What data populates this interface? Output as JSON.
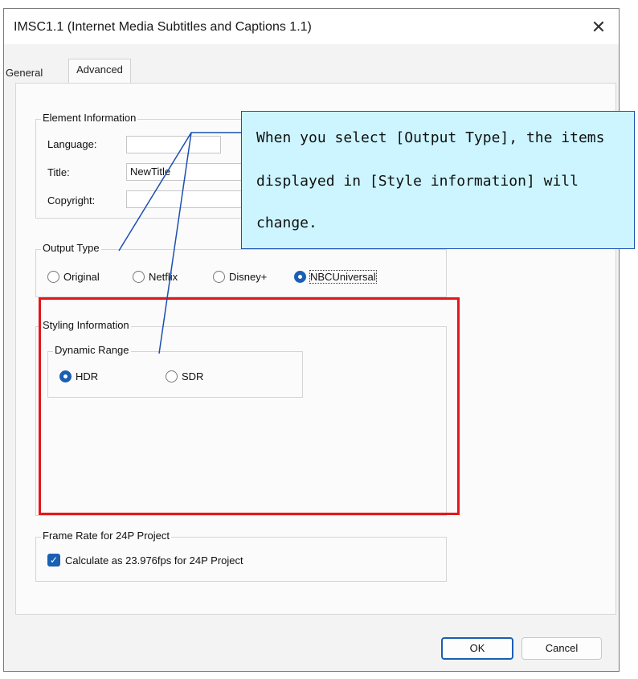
{
  "dialog": {
    "title": "IMSC1.1 (Internet Media Subtitles and Captions 1.1)",
    "close_glyph": "✕",
    "tabs": [
      "General",
      "Advanced"
    ],
    "element_info": {
      "group_label": "Element Information",
      "language_label": "Language:",
      "language_value": "",
      "title_label": "Title:",
      "title_value": "NewTitle",
      "copyright_label": "Copyright:",
      "copyright_value": ""
    },
    "output_type": {
      "group_label": "Output Type",
      "options": [
        "Original",
        "Netflix",
        "Disney+",
        "NBCUniversal"
      ],
      "selected": "NBCUniversal"
    },
    "styling": {
      "group_label": "Styling Information",
      "dynamic_range_label": "Dynamic Range",
      "options": [
        "HDR",
        "SDR"
      ],
      "selected": "HDR"
    },
    "frame_rate": {
      "group_label": "Frame Rate for 24P Project",
      "checkbox_label": "Calculate as 23.976fps for 24P Project",
      "checked": true,
      "check_glyph": "✓"
    },
    "buttons": {
      "ok": "OK",
      "cancel": "Cancel"
    }
  },
  "callout": {
    "lines": [
      "When you select [Output Type], the items",
      "displayed in [Style information] will",
      "change."
    ]
  },
  "colors": {
    "accent": "#1a5fb4",
    "callout_bg": "#ccf5ff",
    "callout_border": "#1c4fb0",
    "highlight": "#e3171b"
  },
  "icons": {
    "close": "close-icon",
    "check": "checkmark-icon"
  }
}
